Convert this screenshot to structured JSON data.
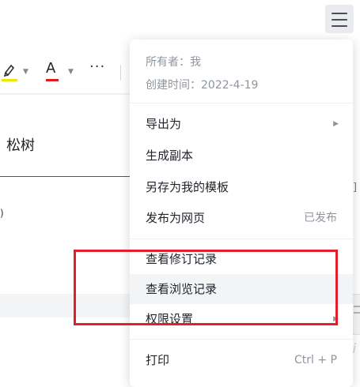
{
  "toolbar": {
    "highlight_icon": "highlighter-icon",
    "font_color_icon": "font-color-icon",
    "font_color_label": "A",
    "more_label": "···",
    "caret": "▼"
  },
  "document": {
    "text": "松树",
    "paren": ")"
  },
  "menu": {
    "owner": "所有者：我",
    "created": "创建时间：2022-4-19",
    "items": [
      {
        "label": "导出为",
        "arrow": "▶"
      },
      {
        "label": "生成副本"
      },
      {
        "label": "另存为我的模板"
      },
      {
        "label": "发布为网页",
        "right": "已发布"
      },
      {
        "label": "查看修订记录"
      },
      {
        "label": "查看浏览记录"
      },
      {
        "label": "权限设置",
        "arrow": "▶"
      },
      {
        "label": "打印",
        "right": "Ctrl + P"
      }
    ]
  },
  "side": {
    "edge_char": "]",
    "watermark": "jii"
  },
  "colors": {
    "highlight": "#f2e600",
    "font_color": "#e0191f",
    "annotation": "#e0202e"
  }
}
